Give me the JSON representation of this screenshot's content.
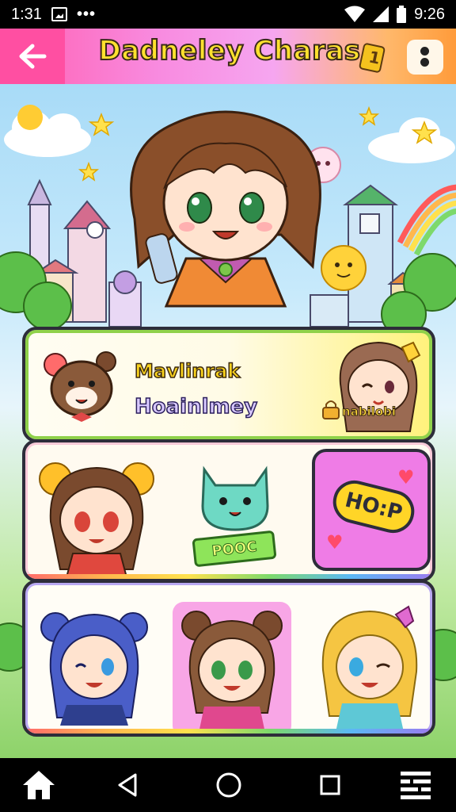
{
  "status_bar": {
    "time_left": "1:31",
    "time_right": "9:26",
    "icons": [
      "gallery-icon",
      "more-dots-icon",
      "wifi-icon",
      "signal-icon",
      "battery-icon"
    ]
  },
  "header": {
    "title": "Dadneley Charas",
    "back_icon": "arrow-left-icon",
    "menu_icon": "menu-dots-icon",
    "colors": {
      "back_bg": "#ff4fa2",
      "title_fill": "#ffe12e",
      "title_stroke": "#3a2a1a"
    }
  },
  "panel_top": {
    "label_main": "Mavlinrak",
    "label_sub": "Hoainlmey",
    "badge_text": "nabilobi"
  },
  "panel_mid": {
    "tag_label": "POOC",
    "hop_label": "HO:P"
  },
  "nav": {
    "items": [
      "home-icon",
      "back-triangle-icon",
      "circle-home-icon",
      "recent-square-icon",
      "menu-lines-icon"
    ]
  }
}
